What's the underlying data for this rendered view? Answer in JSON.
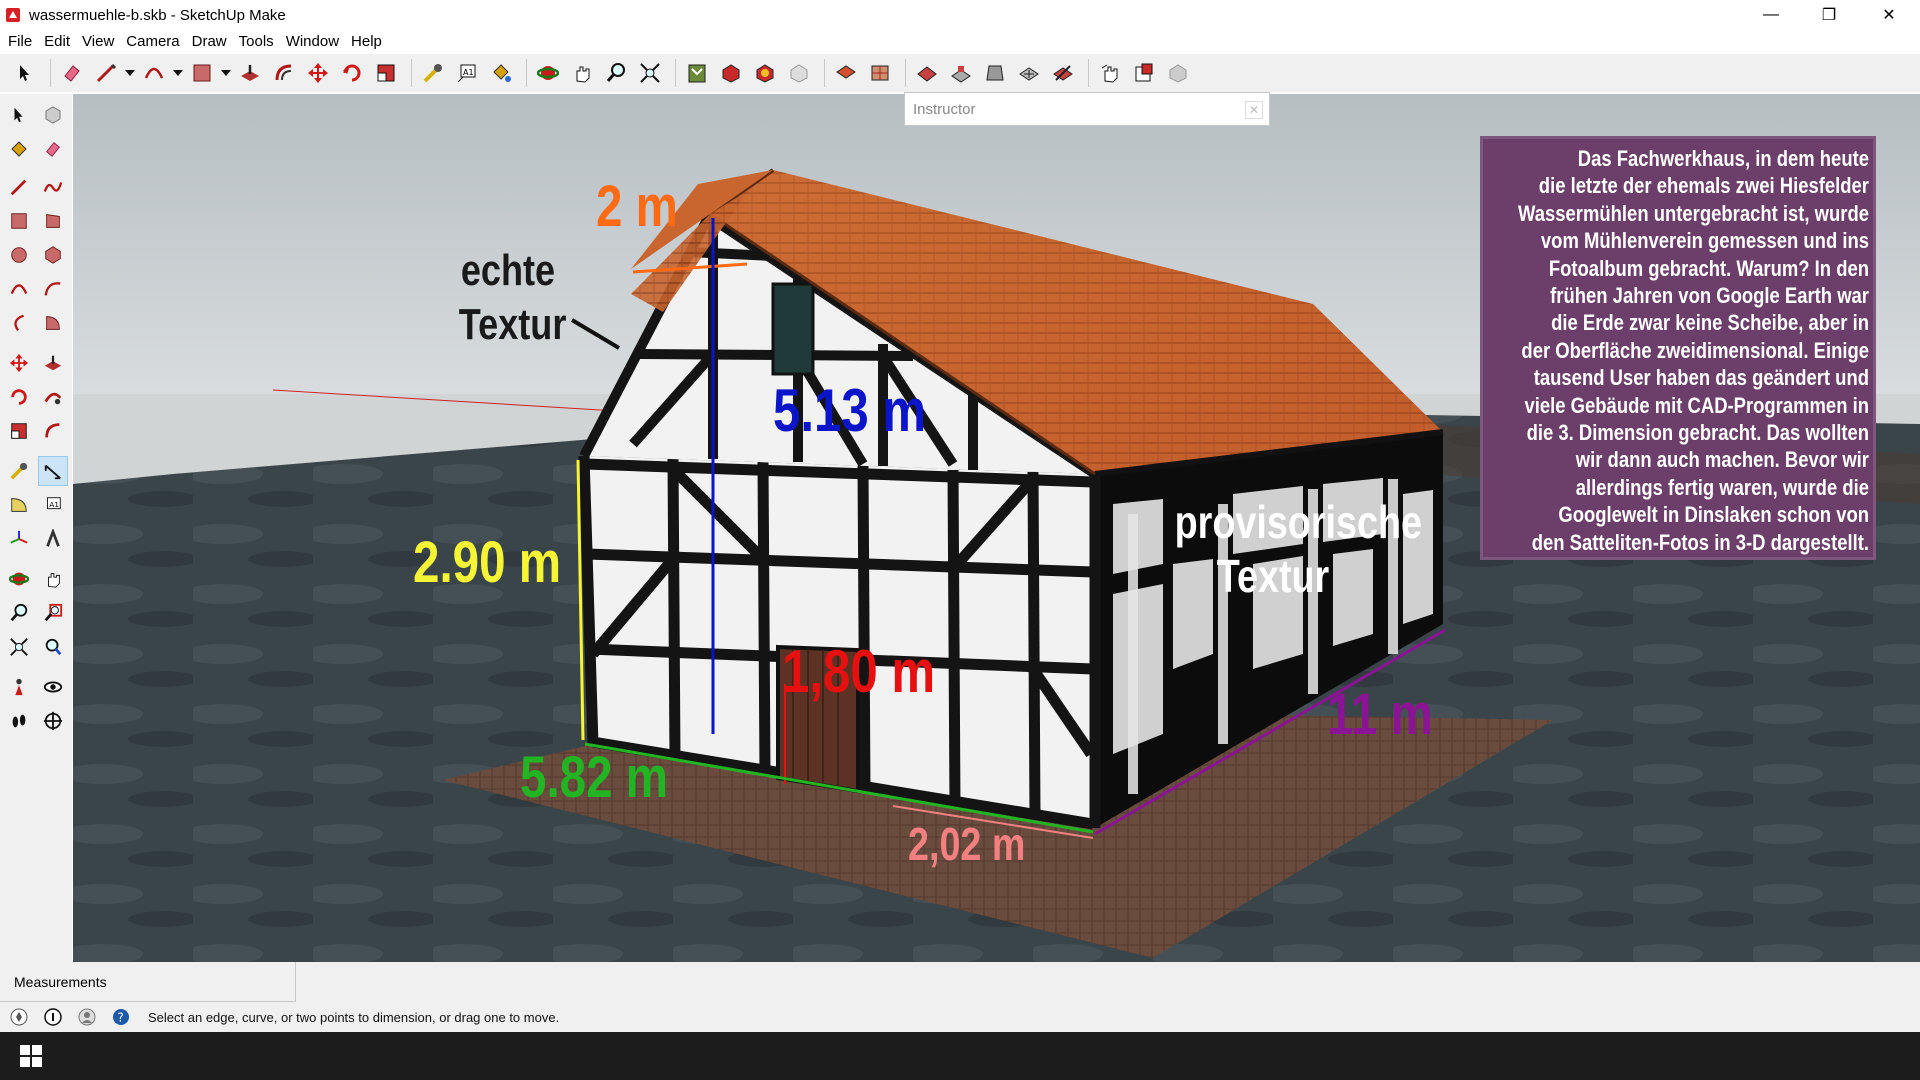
{
  "window": {
    "title": "wassermuehle-b.skb - SketchUp Make",
    "minimize_glyph": "—",
    "maximize_glyph": "❐",
    "close_glyph": "✕"
  },
  "menu": [
    "File",
    "Edit",
    "View",
    "Camera",
    "Draw",
    "Tools",
    "Window",
    "Help"
  ],
  "instructor": {
    "title": "Instructor",
    "close_glyph": "✕"
  },
  "measurements": {
    "label": "Measurements",
    "value": ""
  },
  "status": {
    "text": "Select an edge, curve, or two points to dimension, or drag one to move."
  },
  "annotations": {
    "top_width": "2 m",
    "echte_line1": "echte",
    "echte_line2": "Textur",
    "gable_height": "5.13 m",
    "wall_height": "2.90 m",
    "door_height": "1,80 m",
    "front_width": "5.82 m",
    "door_width": "2,02 m",
    "side_length": "11 m",
    "prov_line1": "provisorische",
    "prov_line2": "Textur"
  },
  "info_box": {
    "lines": [
      "Das Fachwerkhaus, in dem heute",
      "die letzte der ehemals zwei Hiesfelder",
      "Wassermühlen untergebracht ist, wurde",
      "vom Mühlenverein gemessen und ins",
      "Fotoalbum gebracht. Warum? In den",
      "frühen Jahren von Google Earth war",
      "die Erde zwar keine Scheibe, aber in",
      "der Oberfläche zweidimensional. Einige",
      "tausend User haben das geändert und",
      "viele Gebäude mit CAD-Programmen in",
      "die 3. Dimension gebracht. Das wollten",
      "wir dann auch machen. Bevor wir",
      "allerdings fertig waren, wurde die",
      "Googlewelt in Dinslaken schon von",
      "den Satteliten-Fotos in 3-D dargestellt."
    ]
  },
  "colors": {
    "top_width": "#ff6a13",
    "gable_height": "#0a14c8",
    "wall_height": "#f5f536",
    "door_height": "#e5100f",
    "front_width": "#22b422",
    "door_width": "#f28080",
    "side_length": "#8a1493",
    "echte": "#1a1a1a",
    "prov": "#ffffff",
    "info_bg": "#6b3f6a"
  }
}
